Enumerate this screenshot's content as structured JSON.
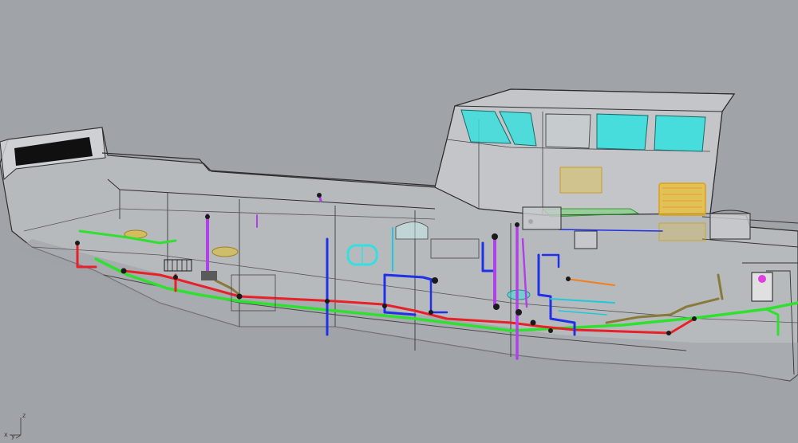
{
  "viewport": {
    "background_color": "#a0a3a8",
    "view": "perspective"
  },
  "model": {
    "name": "",
    "layers": [
      {
        "name": "hull",
        "color": "#3a3a3a"
      },
      {
        "name": "windows",
        "color": "#33e0e0"
      },
      {
        "name": "pipe-red",
        "color": "#e8202a"
      },
      {
        "name": "pipe-green",
        "color": "#2fe02f"
      },
      {
        "name": "pipe-blue",
        "color": "#2030e8"
      },
      {
        "name": "pipe-purple",
        "color": "#b040e8"
      },
      {
        "name": "pipe-cyan",
        "color": "#20c8d8"
      },
      {
        "name": "pipe-yellow",
        "color": "#e8c020"
      },
      {
        "name": "pipe-orange",
        "color": "#f08020"
      },
      {
        "name": "pipe-olive",
        "color": "#8a7a3a"
      }
    ]
  },
  "axis_widget": {
    "z_label": "z",
    "x_label": "x",
    "y_label": "y"
  }
}
